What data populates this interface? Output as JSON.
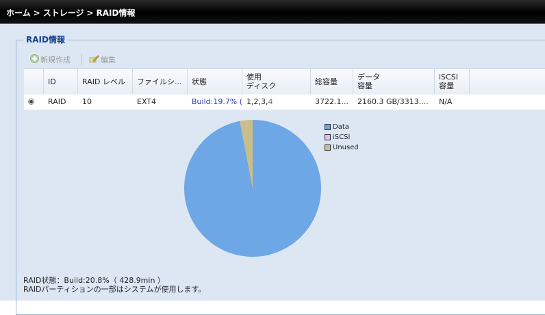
{
  "breadcrumb": {
    "home": "ホーム",
    "storage": "ストレージ",
    "raid_info": "RAID情報",
    "sep": ">"
  },
  "panel": {
    "title": "RAID情報"
  },
  "toolbar": {
    "create_label": "新規作成",
    "edit_label": "編集"
  },
  "grid": {
    "headers": {
      "id": "ID",
      "raid_level": "RAID レベル",
      "filesystem": "ファイルシ...",
      "status": "状態",
      "used_disk_1": "使用",
      "used_disk_2": "ディスク",
      "total_capacity": "総容量",
      "data_capacity_1": "データ",
      "data_capacity_2": "容量",
      "iscsi_capacity_1": "iSCSI",
      "iscsi_capacity_2": "容量"
    },
    "row": {
      "id": "RAID",
      "raid_level": "10",
      "filesystem": "EXT4",
      "status": "Build:19.7% (",
      "disks_active": "1,2,3,",
      "disks_last": "4",
      "total_capacity": "3722.1...",
      "data_capacity": "2160.3 GB/3313....",
      "iscsi_capacity": "N/A"
    }
  },
  "chart_data": {
    "type": "pie",
    "series": [
      {
        "name": "Data",
        "fraction": 0.97,
        "color": "#6ea7e6"
      },
      {
        "name": "iSCSI",
        "fraction": 0.0,
        "color": "#e6b8ef"
      },
      {
        "name": "Unused",
        "fraction": 0.03,
        "color": "#c9bd8a"
      }
    ],
    "legend": "right"
  },
  "status": {
    "raid_state": "RAID状態：Build:20.8%（ 428.9min ）",
    "note": "RAIDパーティションの一部はシステムが使用します。"
  },
  "colors": {
    "header_bar": "#000000",
    "panel_bg": "#dde7f4",
    "panel_title": "#15428b"
  }
}
